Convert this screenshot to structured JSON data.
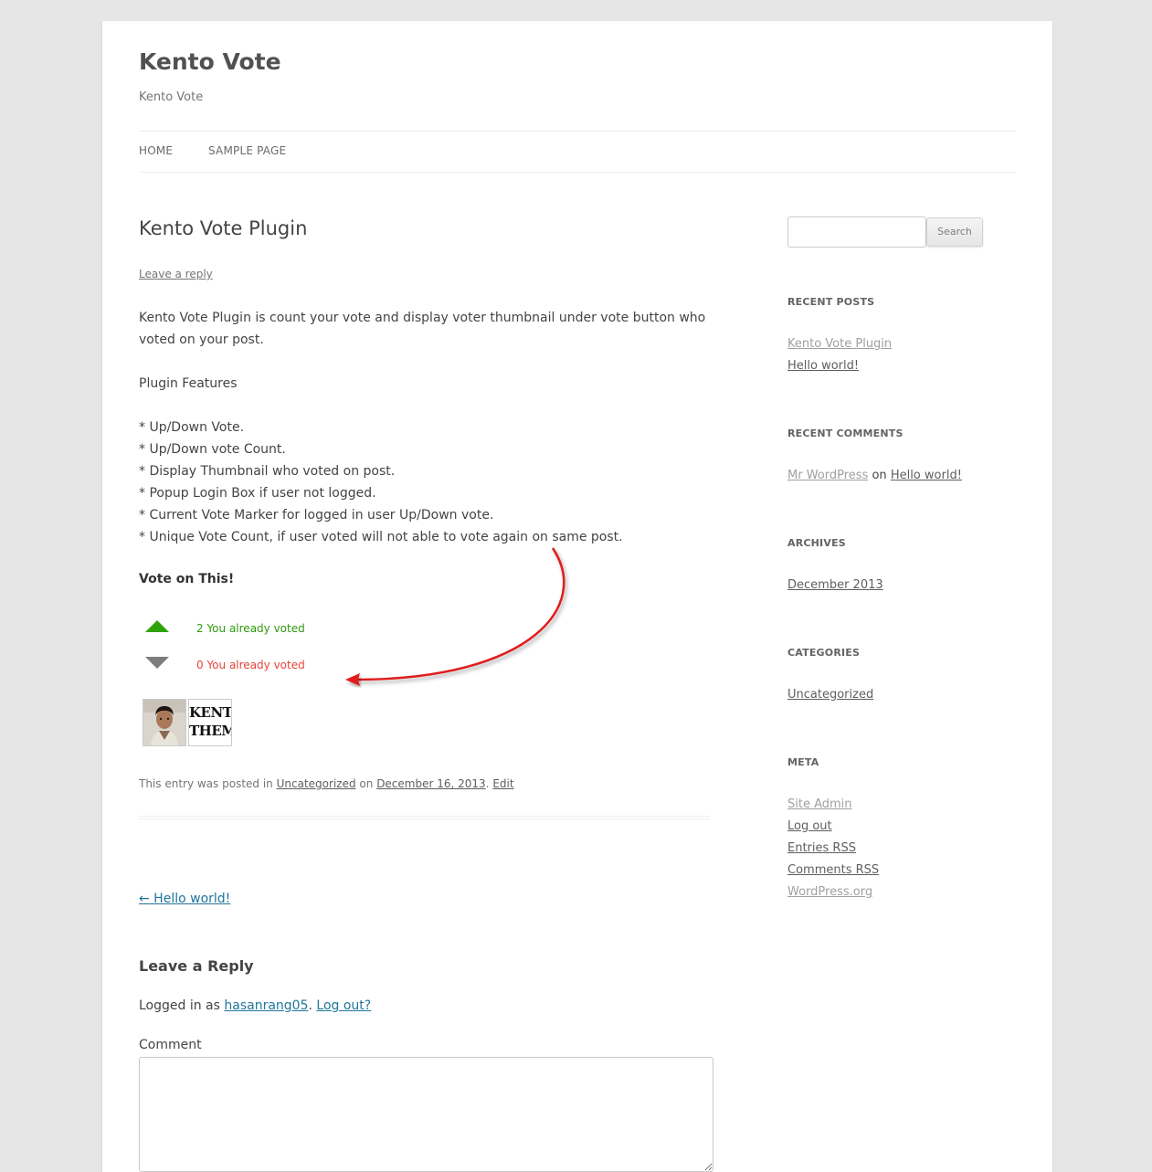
{
  "site": {
    "title": "Kento Vote",
    "description": "Kento Vote"
  },
  "nav": {
    "items": [
      {
        "label": "HOME"
      },
      {
        "label": "SAMPLE PAGE"
      }
    ]
  },
  "post": {
    "title": "Kento Vote Plugin",
    "leave_reply": "Leave a reply",
    "intro_line1": "Kento Vote Plugin is count your vote and display voter thumbnail under vote button who",
    "intro_line2": "voted on your post.",
    "features_heading": "Plugin Features",
    "features": [
      "* Up/Down Vote.",
      "* Up/Down vote Count.",
      "* Display Thumbnail who voted on post.",
      "* Popup Login Box if user not logged.",
      "* Current Vote Marker for logged in user Up/Down vote.",
      "* Unique Vote Count, if user voted will not able to vote again on same post."
    ],
    "vote": {
      "heading": "Vote on This!",
      "up_text": "2 You already voted",
      "down_text": "0 You already voted",
      "logo_line1": "KENTO",
      "logo_line2": "THEMES"
    },
    "meta": {
      "prefix": "This entry was posted in",
      "category": "Uncategorized",
      "on": "on",
      "date": "December 16, 2013",
      "sep": ".",
      "edit": "Edit"
    },
    "prev_link": "← Hello world!"
  },
  "reply": {
    "title": "Leave a Reply",
    "logged_prefix": "Logged in as",
    "user": "hasanrang05",
    "sep": ".",
    "logout": "Log out?",
    "comment_label": "Comment"
  },
  "sidebar": {
    "search_button": "Search",
    "recent_posts": {
      "title": "RECENT POSTS",
      "items": [
        "Kento Vote Plugin",
        "Hello world!"
      ]
    },
    "recent_comments": {
      "title": "RECENT COMMENTS",
      "author": "Mr WordPress",
      "on": "on",
      "post": "Hello world!"
    },
    "archives": {
      "title": "ARCHIVES",
      "items": [
        "December 2013"
      ]
    },
    "categories": {
      "title": "CATEGORIES",
      "items": [
        "Uncategorized"
      ]
    },
    "meta": {
      "title": "META",
      "items": [
        "Site Admin",
        "Log out",
        "Entries RSS",
        "Comments RSS",
        "WordPress.org"
      ]
    }
  },
  "colors": {
    "vote_up": "#2fa30a",
    "vote_down_text": "#e8413a",
    "link_blue": "#21759b",
    "annotation_arrow": "#e01b1b"
  }
}
